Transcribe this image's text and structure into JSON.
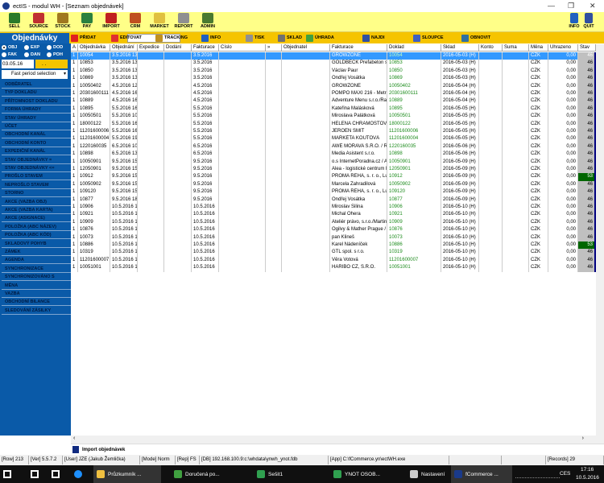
{
  "window": {
    "title": "ectIS - modul WH - [Seznam objednávek]"
  },
  "toolbar": [
    "SELL",
    "SOURCE",
    "STOCK",
    "PAY",
    "IMPORT",
    "CRM",
    "MARKET",
    "REPORT",
    "ADMIN"
  ],
  "toolbar_right": [
    "INFO",
    "QUIT"
  ],
  "section_title": "Objednávky",
  "actions": [
    "PŘIDAT",
    "EDITOVAT",
    "TRACKING",
    "INFO",
    "TISK",
    "SKLAD",
    "ÚHRADA",
    "NAJDI",
    "SLOUPCE",
    "OBNOVIT"
  ],
  "search_value": "",
  "filters": {
    "radios": [
      "OBJ",
      "EXP",
      "DOD",
      "FAK",
      "DAN",
      "POH"
    ],
    "date_from": "03.05.16",
    "date_to": ". .",
    "period": "Fast period selection"
  },
  "sidebar": [
    "ODBĚRATEL",
    "TYP DOKLADU",
    "PŘÍTOMNOST DOKLADU",
    "FORMA ÚHRADY",
    "STAV ÚHRADY",
    "ÚČET",
    "OBCHODNÍ KANÁL",
    "OBCHODNÍ KONTO",
    "EXPEDIČNÍ KANÁL",
    "STAV OBJEDNÁVKY =",
    "STAV OBJEDNÁVKY <=",
    "PROŠLO STAVEM",
    "NEPROŠLO STAVEM",
    "STORNO",
    "AKCE (VAZBA OBJ)",
    "AKCE (VAZBA KARTA)",
    "AKCE (ASIGNACE)",
    "POLOŽKA (ABC NÁZEV)",
    "POLOŽKA (ABC KÓD)",
    "SKLADOVÝ POHYB",
    "ZÁMEK",
    "AGENDA",
    "SYNCHRONIZACE",
    "SYNCHRONIZOVÁNO S",
    "MĚNA",
    "VAZBA",
    "OBCHODNÍ BILANCE",
    "SLEDOVÁNÍ ZÁSILKY"
  ],
  "columns": [
    "A",
    "Objednávka",
    "Objednání",
    "Expedice",
    "Dodání",
    "Fakturace",
    "Číslo",
    "»",
    "Objednatel",
    "Fakturace",
    "Doklad",
    "Sklad",
    "Konto",
    "Suma",
    "Měna",
    "Uhrazeno",
    "Stav"
  ],
  "rows": [
    [
      "1",
      "10054",
      "3.5.2016 13",
      "",
      "",
      "3.5.2016",
      "",
      "",
      "",
      "GROWZONE",
      "10054",
      "2016-05-03 (H)",
      "",
      "",
      "CZK",
      "0,00",
      "46"
    ],
    [
      "1",
      "10853",
      "3.5.2016 13",
      "",
      "",
      "3.5.2016",
      "",
      "",
      "",
      "GOLDBECK Prefabeton s.r.o.",
      "10853",
      "2016-05-03 (H)",
      "",
      "",
      "CZK",
      "0,00",
      "46"
    ],
    [
      "1",
      "10850",
      "3.5.2016 13",
      "",
      "",
      "3.5.2016",
      "",
      "",
      "",
      "Václav Paur",
      "10850",
      "2016-05-03 (H)",
      "",
      "",
      "CZK",
      "0,00",
      "46"
    ],
    [
      "1",
      "10869",
      "3.5.2016 13",
      "",
      "",
      "3.5.2016",
      "",
      "",
      "",
      "Ondřej Vosátka",
      "10869",
      "2016-05-03 (H)",
      "",
      "",
      "CZK",
      "0,00",
      "46"
    ],
    [
      "1",
      "10050402",
      "4.5.2016 12",
      "",
      "",
      "4.5.2016",
      "",
      "",
      "",
      "GROWZONE",
      "10050402",
      "2016-05-04 (H)",
      "",
      "",
      "CZK",
      "0,00",
      "46"
    ],
    [
      "1",
      "20301600111",
      "4.5.2016 16",
      "",
      "",
      "4.5.2016",
      "",
      "",
      "",
      "POMPO MAXI 216 - Metropole",
      "20301600111",
      "2016-05-04 (H)",
      "",
      "",
      "CZK",
      "0,00",
      "46"
    ],
    [
      "1",
      "10889",
      "4.5.2016 16",
      "",
      "",
      "4.5.2016",
      "",
      "",
      "",
      "Adventure Menu s.r.o./Radek S",
      "10889",
      "2016-05-04 (H)",
      "",
      "",
      "CZK",
      "0,00",
      "46"
    ],
    [
      "1",
      "10895",
      "5.5.2016 16",
      "",
      "",
      "5.5.2016",
      "",
      "",
      "",
      "Kateřina Malásková",
      "10895",
      "2016-05-05 (H)",
      "",
      "",
      "CZK",
      "0,00",
      "46"
    ],
    [
      "1",
      "10050501",
      "5.5.2016 10",
      "",
      "",
      "5.5.2016",
      "",
      "",
      "",
      "Miroslava Palátková",
      "10050501",
      "2016-05-05 (H)",
      "",
      "",
      "CZK",
      "0,00",
      "46"
    ],
    [
      "1",
      "18000122",
      "5.5.2016 16",
      "",
      "",
      "5.5.2016",
      "",
      "",
      "",
      "HELENA CHRAMOSTOVÁ",
      "18000122",
      "2016-05-05 (H)",
      "",
      "",
      "CZK",
      "0,00",
      "46"
    ],
    [
      "1",
      "11201600006",
      "5.5.2016 16",
      "",
      "",
      "5.5.2016",
      "",
      "",
      "",
      "JEROEN SMIT",
      "11201600006",
      "2016-05-05 (H)",
      "",
      "",
      "CZK",
      "0,00",
      "46"
    ],
    [
      "1",
      "11201600004",
      "5.5.2016 19",
      "",
      "",
      "5.5.2016",
      "",
      "",
      "",
      "MARKÉTA KOUTOVÁ",
      "11201600004",
      "2016-05-05 (H)",
      "",
      "",
      "CZK",
      "0,00",
      "46"
    ],
    [
      "1",
      "1220160035",
      "6.5.2016 10",
      "",
      "",
      "6.5.2016",
      "",
      "",
      "",
      "AWE MORAVA S.R.O. / ROMA",
      "1220160035",
      "2016-05-06 (H)",
      "",
      "",
      "CZK",
      "0,00",
      "46"
    ],
    [
      "1",
      "10898",
      "6.5.2016 13",
      "",
      "",
      "6.5.2016",
      "",
      "",
      "",
      "Media Asistent s.r.o.",
      "10898",
      "2016-05-06 (H)",
      "",
      "",
      "CZK",
      "0,00",
      "46"
    ],
    [
      "1",
      "10050901",
      "9.5.2016 15",
      "",
      "",
      "9.5.2016",
      "",
      "",
      "",
      "o.s InternetPoradna.cz / Andrea",
      "10050901",
      "2016-05-09 (H)",
      "",
      "",
      "CZK",
      "0,00",
      "46"
    ],
    [
      "1",
      "12050901",
      "9.5.2016 15",
      "",
      "",
      "9.5.2016",
      "",
      "",
      "",
      "Alea - logistické centrum Hor",
      "12050901",
      "2016-05-09 (H)",
      "",
      "",
      "CZK",
      "0,00",
      "46"
    ],
    [
      "1",
      "10912",
      "9.5.2016 15",
      "",
      "",
      "9.5.2016",
      "",
      "",
      "",
      "PROMA REHA, s. r. o., Lukáš C",
      "10912",
      "2016-05-09 (H)",
      "",
      "",
      "CZK",
      "0,00",
      "53"
    ],
    [
      "1",
      "10050902",
      "9.5.2016 15",
      "",
      "",
      "9.5.2016",
      "",
      "",
      "",
      "Marcela Zahradilová",
      "10050902",
      "2016-05-09 (H)",
      "",
      "",
      "CZK",
      "0,00",
      "46"
    ],
    [
      "1",
      "109120",
      "9.5.2016 15",
      "",
      "",
      "9.5.2016",
      "",
      "",
      "",
      "PROMA REHA, s. r. o., Lukáš C",
      "109120",
      "2016-05-09 (H)",
      "",
      "",
      "CZK",
      "0,00",
      "46"
    ],
    [
      "1",
      "10877",
      "9.5.2016 18",
      "",
      "",
      "9.5.2016",
      "",
      "",
      "",
      "Ondřej Vosátka",
      "10877",
      "2016-05-09 (H)",
      "",
      "",
      "CZK",
      "0,00",
      "46"
    ],
    [
      "1",
      "10906",
      "10.5.2016 1",
      "",
      "",
      "10.5.2016",
      "",
      "",
      "",
      "Miroslav Šilina",
      "10906",
      "2016-05-10 (H)",
      "",
      "",
      "CZK",
      "0,00",
      "46"
    ],
    [
      "1",
      "10921",
      "10.5.2016 1",
      "",
      "",
      "10.5.2016",
      "",
      "",
      "",
      "Michal Ohera",
      "10921",
      "2016-05-10 (H)",
      "",
      "",
      "CZK",
      "0,00",
      "46"
    ],
    [
      "1",
      "10909",
      "10.5.2016 1",
      "",
      "",
      "10.5.2016",
      "",
      "",
      "",
      "Ateliér právo, s.r.o./Martina Čink",
      "10909",
      "2016-05-10 (H)",
      "",
      "",
      "CZK",
      "0,00",
      "46"
    ],
    [
      "1",
      "10876",
      "10.5.2016 1",
      "",
      "",
      "10.5.2016",
      "",
      "",
      "",
      "Ogilvy & Mather Prague / Tomáš",
      "10876",
      "2016-05-10 (H)",
      "",
      "",
      "CZK",
      "0,00",
      "46"
    ],
    [
      "1",
      "10073",
      "10.5.2016 1",
      "",
      "",
      "10.5.2016",
      "",
      "",
      "",
      "pan Klineš",
      "10073",
      "2016-05-10 (H)",
      "",
      "",
      "CZK",
      "0,00",
      "46"
    ],
    [
      "1",
      "10886",
      "10.5.2016 1",
      "",
      "",
      "10.5.2016",
      "",
      "",
      "",
      "Karel Nádeníček",
      "10886",
      "2016-05-10 (H)",
      "",
      "",
      "CZK",
      "0,00",
      "53"
    ],
    [
      "1",
      "10319",
      "10.5.2016 1",
      "",
      "",
      "10.5.2016",
      "",
      "",
      "",
      "GTL spol. s r.o.",
      "10319",
      "2016-05-10 (H)",
      "",
      "",
      "CZK",
      "0,00",
      "46"
    ],
    [
      "1",
      "11201600007",
      "10.5.2016 1",
      "",
      "",
      "10.5.2016",
      "",
      "",
      "",
      "Věra Votová",
      "11201600007",
      "2016-05-10 (H)",
      "",
      "",
      "CZK",
      "0,00",
      "46"
    ],
    [
      "1",
      "10051001",
      "10.5.2016 1",
      "",
      "",
      "10.5.2016",
      "",
      "",
      "",
      "HARIBO CZ, S.R.O.",
      "10051001",
      "2016-05-10 (H)",
      "",
      "",
      "CZK",
      "0,00",
      "46"
    ]
  ],
  "selected_row": 0,
  "import_panel": "Import objednávek",
  "status": [
    "[Row] 213",
    "[Ver] 5.5.7.2",
    "[User] JZE (Jakub Žemlička)",
    "[Mode] Norm",
    "[Rep] FS",
    "[DB] 192.168.100.9:c:\\whdata\\ynwh_ynot.fdb",
    "[App] C:\\fCommerce.yn\\ectWH.exe",
    "",
    "",
    "[Records] 29"
  ],
  "taskbar": {
    "apps": [
      "Průzkumník ...",
      "Doručená po...",
      "Sešit1",
      "YNOT OSOB...",
      "Nastavení",
      "fCommerce ..."
    ],
    "lang": "CES",
    "time": "17:16",
    "date": "10.5.2016"
  },
  "colors": {
    "toolbar": "#ffff88",
    "actionbar": "#f5c400",
    "sidebar": "#0a5aa8",
    "selected": "#3399ff",
    "stav_highlight": "#006600"
  }
}
